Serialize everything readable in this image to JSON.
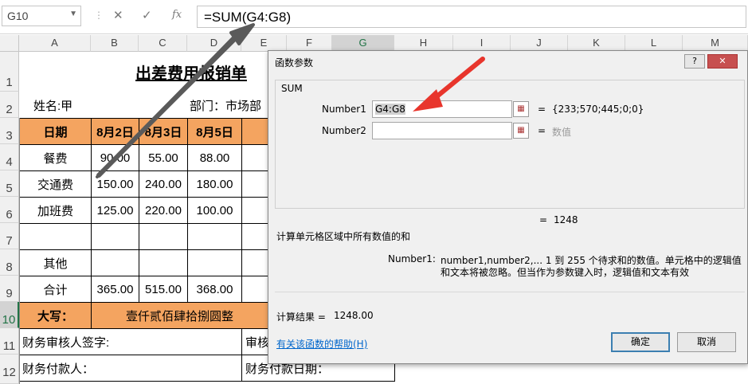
{
  "formula_bar": {
    "name_box": "G10",
    "cancel": "✕",
    "enter": "✓",
    "fx": "fx",
    "formula": "=SUM(G4:G8)"
  },
  "columns": [
    "A",
    "B",
    "C",
    "D",
    "E",
    "F",
    "G",
    "H",
    "I",
    "J",
    "K",
    "L",
    "M"
  ],
  "rows": [
    "1",
    "2",
    "3",
    "4",
    "5",
    "6",
    "7",
    "8",
    "9",
    "10",
    "11",
    "12"
  ],
  "sheet": {
    "title": "出差费用报销单",
    "name_label": "姓名:甲",
    "dept_label": "部门：市场部",
    "header": [
      "日期",
      "8月2日",
      "8月3日",
      "8月5日"
    ],
    "items": [
      {
        "label": "餐费",
        "v": [
          "90.00",
          "55.00",
          "88.00"
        ]
      },
      {
        "label": "交通费",
        "v": [
          "150.00",
          "240.00",
          "180.00"
        ]
      },
      {
        "label": "加班费",
        "v": [
          "125.00",
          "220.00",
          "100.00"
        ]
      },
      {
        "label": "",
        "v": [
          "",
          "",
          ""
        ]
      },
      {
        "label": "其他",
        "v": [
          "",
          "",
          ""
        ]
      },
      {
        "label": "合计",
        "v": [
          "365.00",
          "515.00",
          "368.00"
        ]
      }
    ],
    "daxie_label": "大写：",
    "daxie_value": "壹仟贰佰肆拾捌圆整",
    "audit_sign": "财务审核人签字:",
    "audit_short": "审核",
    "payer": "财务付款人：",
    "pay_date": "财务付款日期："
  },
  "dialog": {
    "title": "函数参数",
    "help": "?",
    "close": "✕",
    "function_name": "SUM",
    "arg1_label": "Number1",
    "arg1_value": "G4:G8",
    "arg1_result": "{233;570;445;0;0}",
    "arg2_label": "Number2",
    "arg2_value": "",
    "arg2_result": "数值",
    "eq": "=",
    "total_result": "1248",
    "description": "计算单元格区域中所有数值的和",
    "arg_help_label": "Number1:",
    "arg_help_line1": "number1,number2,...  1 到 255 个待求和的数值。单元格中的逻辑值",
    "arg_help_line2": "和文本将被忽略。但当作为参数键入时，逻辑值和文本有效",
    "calc_result_label": "计算结果 =",
    "calc_result_value": "1248.00",
    "help_link": "有关该函数的帮助(H)",
    "ok": "确定",
    "cancel": "取消"
  },
  "colors": {
    "header_orange": "#f4a460",
    "excel_green": "#217346",
    "arrow_red": "#e8352c",
    "arrow_gray": "#5a5a5a"
  }
}
